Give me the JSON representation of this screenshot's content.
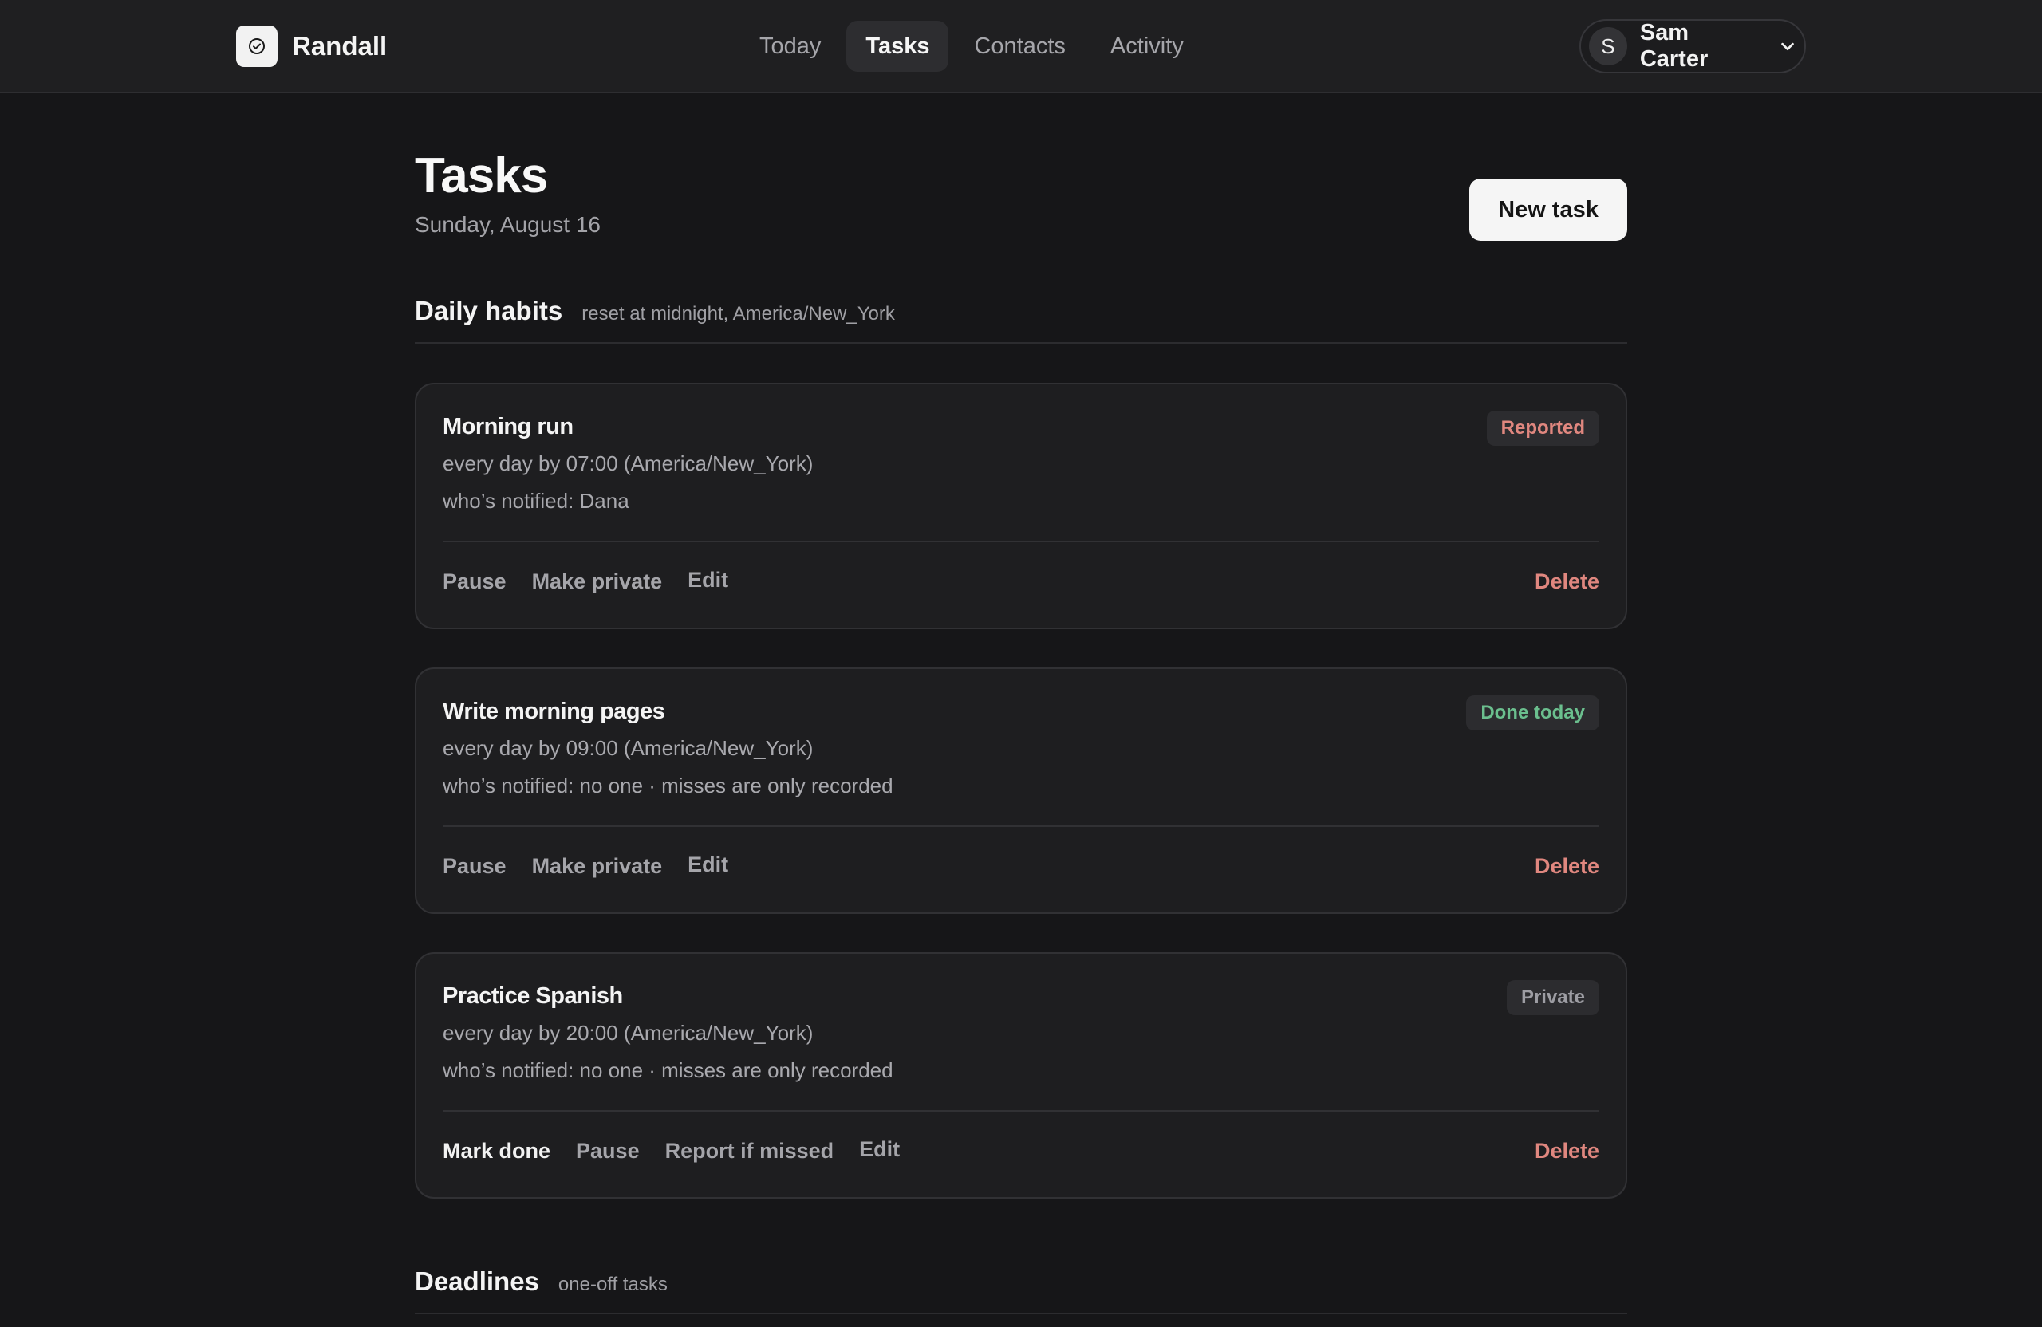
{
  "brand": {
    "name": "Randall",
    "logo_icon": "check-circle-icon"
  },
  "nav": {
    "items": [
      {
        "label": "Today",
        "active": false
      },
      {
        "label": "Tasks",
        "active": true
      },
      {
        "label": "Contacts",
        "active": false
      },
      {
        "label": "Activity",
        "active": false
      }
    ]
  },
  "user": {
    "initial": "S",
    "name": "Sam Carter",
    "menu_icon": "chevron-down-icon"
  },
  "page": {
    "title": "Tasks",
    "date": "Sunday, August 16",
    "new_task_label": "New task"
  },
  "daily": {
    "title": "Daily habits",
    "subtitle": "reset at midnight, America/New_York",
    "cards": [
      {
        "title": "Morning run",
        "schedule": "every day by 07:00 (America/New_York)",
        "notified": "who’s notified: Dana",
        "badge": "Reported",
        "actions": [
          "Pause",
          "Make private",
          "Edit"
        ],
        "delete_label": "Delete"
      },
      {
        "title": "Write morning pages",
        "schedule": "every day by 09:00 (America/New_York)",
        "notified": "who’s notified: no one · misses are only recorded",
        "badge": "Done today",
        "actions": [
          "Pause",
          "Make private",
          "Edit"
        ],
        "delete_label": "Delete"
      },
      {
        "title": "Practice Spanish",
        "schedule": "every day by 20:00 (America/New_York)",
        "notified": "who’s notified: no one · misses are only recorded",
        "badge": "Private",
        "actions": [
          "Mark done",
          "Pause",
          "Report if missed",
          "Edit"
        ],
        "delete_label": "Delete"
      }
    ]
  },
  "deadlines": {
    "title": "Deadlines",
    "subtitle": "one-off tasks"
  },
  "colors": {
    "background": "#161618",
    "card": "#1e1e20",
    "danger": "#e0877f",
    "success": "#6bbf8e"
  }
}
